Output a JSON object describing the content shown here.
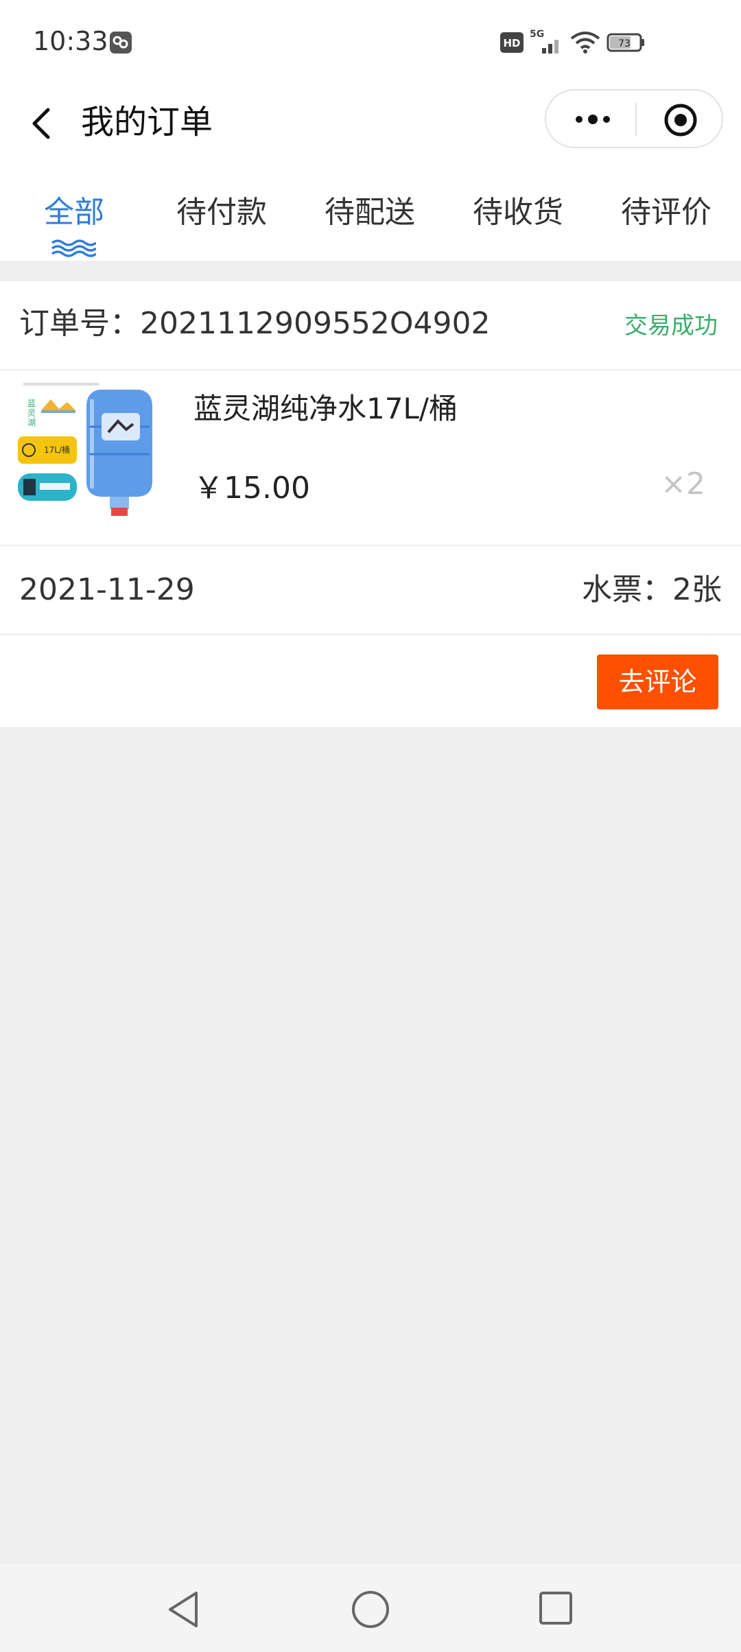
{
  "status_bar": {
    "time": "10:33",
    "battery": "73",
    "network": "5G",
    "hd_badge": "HD"
  },
  "header": {
    "title": "我的订单"
  },
  "tabs": [
    {
      "label": "全部",
      "active": true
    },
    {
      "label": "待付款",
      "active": false
    },
    {
      "label": "待配送",
      "active": false
    },
    {
      "label": "待收货",
      "active": false
    },
    {
      "label": "待评价",
      "active": false
    }
  ],
  "order": {
    "number_label": "订单号：2021112909552O4902",
    "status": "交易成功",
    "product": {
      "name": "蓝灵湖纯净水17L/桶",
      "price": "￥15.00",
      "quantity": "×2"
    },
    "date": "2021-11-29",
    "tickets": "水票：2张",
    "review_button": "去评论"
  },
  "colors": {
    "accent": "#2e7cd6",
    "success": "#3cae6a",
    "button": "#ff5000",
    "background": "#efefef"
  }
}
